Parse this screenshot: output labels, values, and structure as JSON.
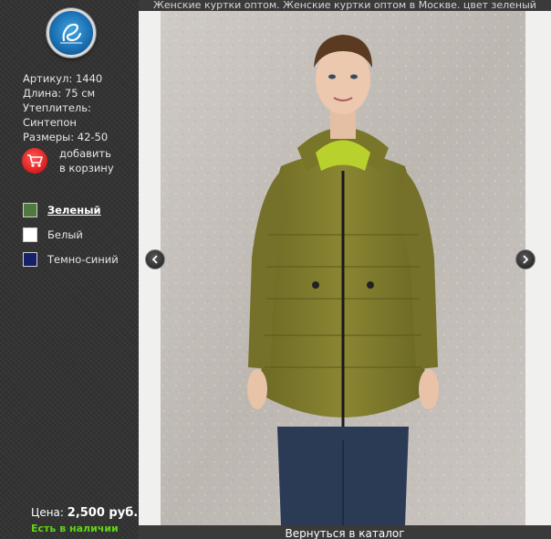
{
  "header": {
    "title": "Женские куртки оптом. Женские куртки оптом в Москве. цвет зеленый"
  },
  "logo": {
    "icon": "logo-emblem-icon"
  },
  "product": {
    "article": "Артикул: 1440",
    "length": "Длина: 75 см",
    "insulation_label": "Утеплитель:",
    "insulation_value": "Синтепон",
    "sizes": "Размеры: 42-50"
  },
  "cart": {
    "label_line1": "добавить",
    "label_line2": "в корзину",
    "icon": "shopping-cart-icon",
    "color": "#d91c1c"
  },
  "colors": [
    {
      "label": "Зеленый",
      "swatch": "#4e7a3e",
      "active": true
    },
    {
      "label": "Белый",
      "swatch": "#ffffff",
      "active": false
    },
    {
      "label": "Темно-синий",
      "swatch": "#14206a",
      "active": false
    }
  ],
  "price": {
    "label": "Цена:",
    "value": "2,500 руб.",
    "stock": "Есть в наличии",
    "stock_color": "#5fd317"
  },
  "gallery": {
    "prev_icon": "chevron-left-icon",
    "next_icon": "chevron-right-icon"
  },
  "footer": {
    "back_link": "Вернуться в каталог"
  }
}
